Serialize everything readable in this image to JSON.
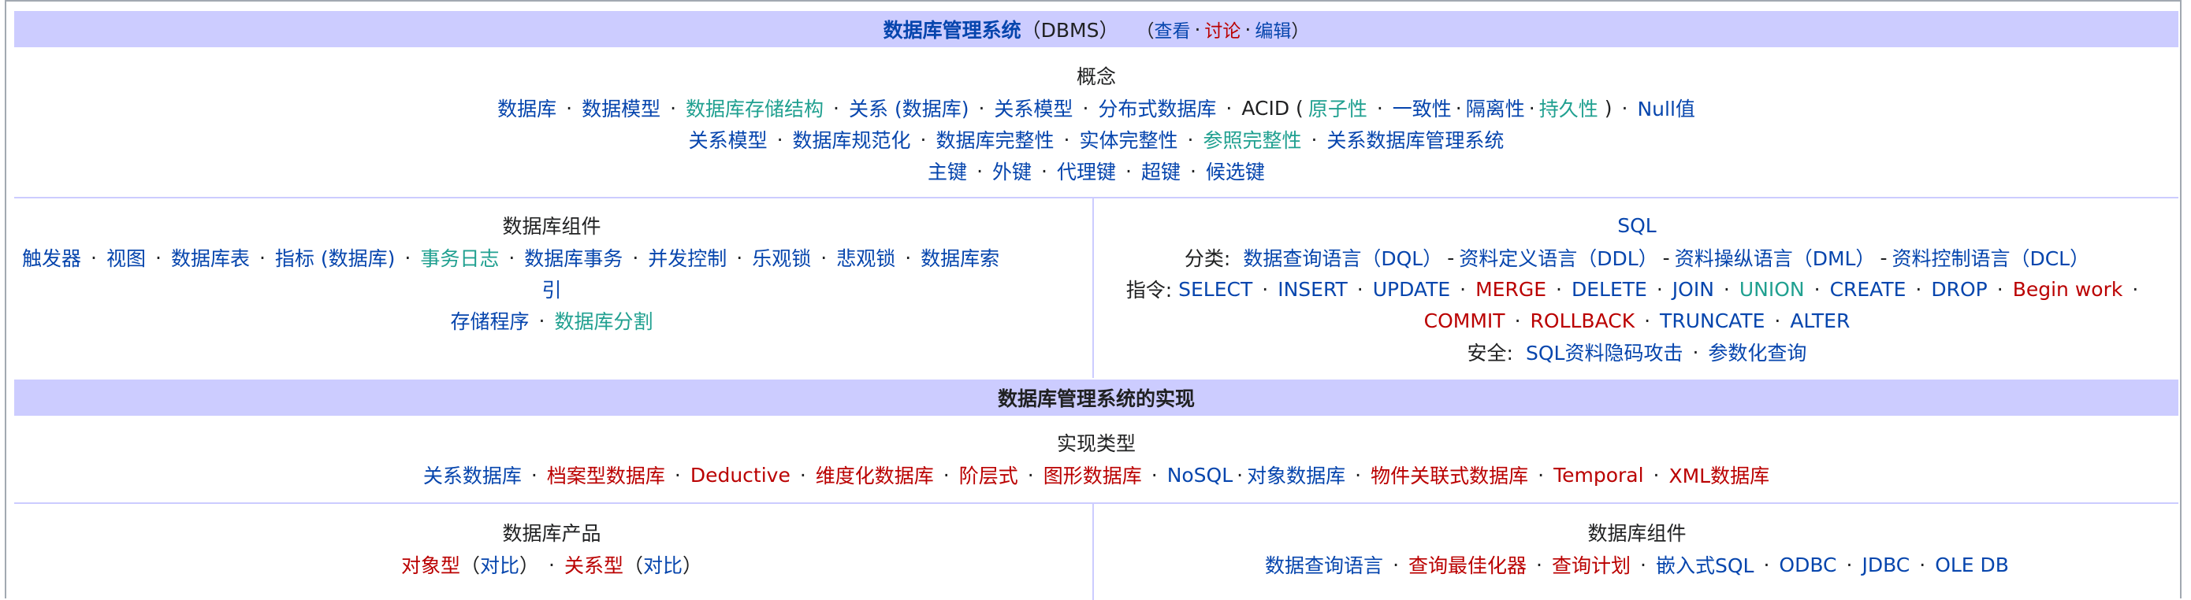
{
  "header": {
    "title": "数据库管理系统",
    "abbr": "（DBMS）",
    "links": [
      "查看",
      "讨论",
      "编辑"
    ],
    "paren_open": "（",
    "paren_close": "）"
  },
  "concepts": {
    "heading": "概念",
    "row1": [
      "数据库",
      "数据模型",
      "数据库存储结构",
      "关系 (数据库)",
      "关系模型",
      "分布式数据库"
    ],
    "acid_label": "ACID (",
    "acid_items": [
      "原子性",
      "一致性",
      "隔离性",
      "持久性"
    ],
    "acid_close": ")",
    "null_value": "Null值",
    "row2": [
      "关系模型",
      "数据库规范化",
      "数据库完整性",
      "实体完整性",
      "参照完整性",
      "关系数据库管理系统"
    ],
    "row3": [
      "主键",
      "外键",
      "代理键",
      "超键",
      "候选键"
    ]
  },
  "components": {
    "heading": "数据库组件",
    "row1": [
      "触发器",
      "视图",
      "数据库表",
      "指标 (数据库)",
      "事务日志",
      "数据库事务",
      "并发控制",
      "乐观锁",
      "悲观锁"
    ],
    "index_part1": "数据库索",
    "index_part2": "引",
    "row2": [
      "存储程序",
      "数据库分割"
    ]
  },
  "sql": {
    "heading": "SQL",
    "class_label": "分类:",
    "classes": [
      "数据查询语言（DQL）",
      "资料定义语言（DDL）",
      "资料操纵语言（DML）",
      "资料控制语言（DCL）"
    ],
    "dash": "-",
    "cmd_label": "指令:",
    "commands1": [
      "SELECT",
      "INSERT",
      "UPDATE",
      "MERGE",
      "DELETE",
      "JOIN",
      "UNION",
      "CREATE",
      "DROP",
      "Begin work"
    ],
    "commands2": [
      "COMMIT",
      "ROLLBACK",
      "TRUNCATE",
      "ALTER"
    ],
    "security_label": "安全:",
    "security": [
      "SQL资料隐码攻击",
      "参数化查询"
    ]
  },
  "impl_band": "数据库管理系统的实现",
  "impl_types": {
    "heading": "实现类型",
    "items": [
      "关系数据库",
      "档案型数据库",
      "Deductive",
      "维度化数据库",
      "阶层式",
      "图形数据库",
      "NoSQL",
      "对象数据库",
      "物件关联式数据库",
      "Temporal",
      "XML数据库"
    ]
  },
  "products": {
    "heading": "数据库产品",
    "items": [
      "对象型",
      "对比",
      "关系型",
      "对比"
    ]
  },
  "components2": {
    "heading": "数据库组件",
    "items": [
      "数据查询语言",
      "查询最佳化器",
      "查询计划",
      "嵌入式SQL",
      "ODBC",
      "JDBC",
      "OLE DB"
    ]
  },
  "colors": {
    "link": "#0645ad",
    "visited": "#20a090",
    "redlink": "#ba0000",
    "band": "#ccccff"
  }
}
